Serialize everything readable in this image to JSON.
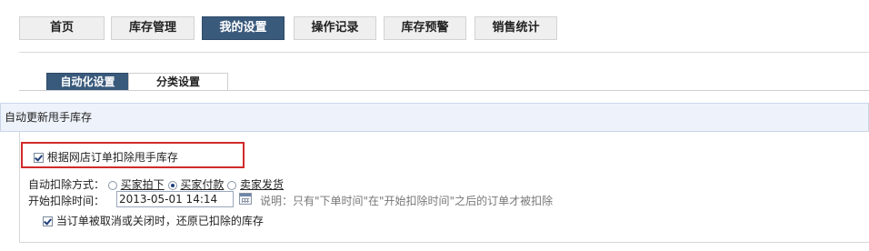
{
  "nav": {
    "tabs": [
      {
        "label": "首页",
        "active": false
      },
      {
        "label": "库存管理",
        "active": false
      },
      {
        "label": "我的设置",
        "active": true
      },
      {
        "label": "操作记录",
        "active": false
      },
      {
        "label": "库存预警",
        "active": false
      },
      {
        "label": "销售统计",
        "active": false
      }
    ]
  },
  "subnav": {
    "tabs": [
      {
        "label": "自动化设置",
        "active": true
      },
      {
        "label": "分类设置",
        "active": false
      }
    ]
  },
  "panel": {
    "title": "自动更新甩手库存",
    "main_checkbox": {
      "label": "根据网店订单扣除甩手库存",
      "checked": true
    },
    "deduct_mode": {
      "label": "自动扣除方式：",
      "options": [
        {
          "label": "买家拍下",
          "selected": false
        },
        {
          "label": "买家付款",
          "selected": true
        },
        {
          "label": "卖家发货",
          "selected": false
        }
      ]
    },
    "start_time": {
      "label": "开始扣除时间：",
      "value": "2013-05-01 14:14",
      "note": "说明：只有\"下单时间\"在\"开始扣除时间\"之后的订单才被扣除"
    },
    "restore_checkbox": {
      "label": "当订单被取消或关闭时，还原已扣除的库存",
      "checked": true
    }
  },
  "colors": {
    "active_tab": "#3a5a7c",
    "highlight_border": "#d12a2a",
    "panel_head_bg": "#eef3fb"
  }
}
